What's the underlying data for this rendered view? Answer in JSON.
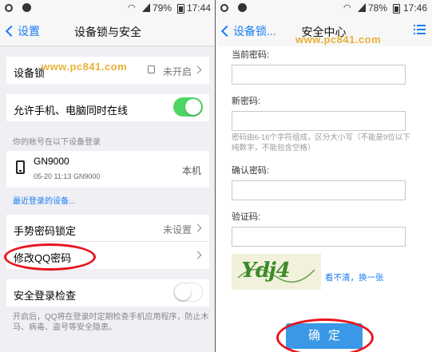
{
  "left": {
    "status": {
      "battery": "79%",
      "time": "17:44"
    },
    "nav": {
      "back": "设置",
      "title": "设备锁与安全"
    },
    "watermark": "www.pc841.com",
    "device_lock": {
      "label": "设备锁",
      "value": "未开启"
    },
    "online": {
      "label": "允许手机、电脑同时在线",
      "state": "on"
    },
    "devices_caption": "你的帐号在以下设备登录",
    "device": {
      "name": "GN9000",
      "detail": "05-20 11:13 GN9000",
      "type": "本机"
    },
    "recent_link": "最近登录的设备...",
    "gesture": {
      "label": "手势密码锁定",
      "value": "未设置"
    },
    "change_pwd": {
      "label": "修改QQ密码"
    },
    "secure_login": {
      "label": "安全登录检查",
      "state": "off"
    },
    "secure_desc": "开启后，QQ将在登录时定期检查手机应用程序，防止木马、病毒、盗号等安全隐患。",
    "highlight_color": "#e8141d"
  },
  "right": {
    "status": {
      "battery": "78%",
      "time": "17:46"
    },
    "nav": {
      "back": "设备锁...",
      "title": "安全中心",
      "menu_icon": "list-icon"
    },
    "watermark": "www.pc841.com",
    "current_pwd_label": "当前密码:",
    "new_pwd_label": "新密码:",
    "pwd_hint": "密码由6-16个字符组成，区分大小写（不能是9位以下纯数字，不能包含空格）",
    "confirm_pwd_label": "确认密码:",
    "captcha_label": "验证码:",
    "captcha_text": "Ydj4",
    "refresh_link": "看不清，换一张",
    "confirm_button": "确定",
    "accent": "#3a98e6"
  }
}
